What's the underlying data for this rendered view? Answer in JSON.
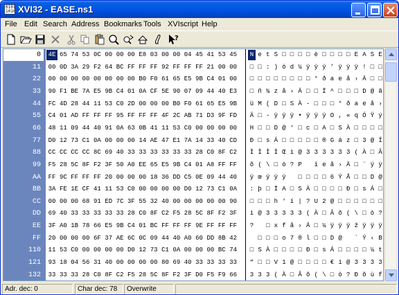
{
  "window": {
    "title": "XVI32 - EASE.ns1"
  },
  "menu": [
    "File",
    "Edit",
    "Search",
    "Address",
    "Bookmarks",
    "Tools",
    "XVIscript",
    "Help"
  ],
  "toolbar": [
    "new-file-icon",
    "open-folder-icon",
    "save-icon",
    "delete-icon",
    "cut-icon",
    "copy-icon",
    "paste-icon",
    "find-icon",
    "find-next-icon",
    "settings-icon",
    "script-icon",
    "help-pointer-icon"
  ],
  "rows": [
    {
      "addr": "0",
      "hex": [
        "4E",
        "65",
        "74",
        "53",
        "0C",
        "00",
        "00",
        "00",
        "E8",
        "03",
        "00",
        "00",
        "04",
        "45",
        "41",
        "53",
        "45"
      ],
      "txt": [
        "N",
        "e",
        "t",
        "S",
        "□",
        "□",
        "□",
        "□",
        "è",
        "□",
        "□",
        "□",
        "□",
        "E",
        "A",
        "S",
        "E"
      ]
    },
    {
      "addr": "11",
      "hex": [
        "00",
        "0D",
        "3A",
        "29",
        "F2",
        "64",
        "BC",
        "FF",
        "FF",
        "FF",
        "92",
        "FF",
        "FF",
        "FF",
        "21",
        "00",
        "00"
      ],
      "txt": [
        "□",
        "□",
        ":",
        ")",
        "ò",
        "d",
        "¼",
        "ÿ",
        "ÿ",
        "ÿ",
        "’",
        "ÿ",
        "ÿ",
        "ÿ",
        "!",
        "□",
        "□"
      ]
    },
    {
      "addr": "22",
      "hex": [
        "00",
        "00",
        "00",
        "00",
        "00",
        "00",
        "00",
        "00",
        "B0",
        "F0",
        "61",
        "65",
        "E5",
        "9B",
        "C4",
        "01",
        "00"
      ],
      "txt": [
        "□",
        "□",
        "□",
        "□",
        "□",
        "□",
        "□",
        "□",
        "°",
        "ð",
        "a",
        "e",
        "å",
        "›",
        "Ä",
        "□",
        "□"
      ]
    },
    {
      "addr": "33",
      "hex": [
        "90",
        "F1",
        "BE",
        "7A",
        "E5",
        "9B",
        "C4",
        "01",
        "0A",
        "CF",
        "5E",
        "90",
        "07",
        "09",
        "44",
        "40",
        "E3"
      ],
      "txt": [
        "□",
        "ñ",
        "¾",
        "z",
        "å",
        "›",
        "Ä",
        "□",
        "□",
        "Ï",
        "^",
        "□",
        "□",
        "□",
        "D",
        "@",
        "ã"
      ]
    },
    {
      "addr": "44",
      "hex": [
        "FC",
        "4D",
        "28",
        "44",
        "11",
        "53",
        "C0",
        "2D",
        "00",
        "00",
        "00",
        "B0",
        "F0",
        "61",
        "65",
        "E5",
        "9B"
      ],
      "txt": [
        "ü",
        "M",
        "(",
        "D",
        "□",
        "S",
        "À",
        "-",
        "□",
        "□",
        "□",
        "°",
        "ð",
        "a",
        "e",
        "å",
        "›"
      ]
    },
    {
      "addr": "55",
      "hex": [
        "C4",
        "01",
        "AD",
        "FF",
        "FF",
        "FF",
        "95",
        "FF",
        "FF",
        "FF",
        "4F",
        "2C",
        "AB",
        "71",
        "D3",
        "9F",
        "FD"
      ],
      "txt": [
        "Ä",
        "□",
        "-",
        "ÿ",
        "ÿ",
        "ÿ",
        "•",
        "ÿ",
        "ÿ",
        "ÿ",
        "O",
        ",",
        "«",
        "q",
        "Ó",
        "Ÿ",
        "ý"
      ]
    },
    {
      "addr": "66",
      "hex": [
        "48",
        "11",
        "09",
        "44",
        "40",
        "91",
        "0A",
        "63",
        "0B",
        "41",
        "11",
        "53",
        "C0",
        "00",
        "00",
        "00",
        "00"
      ],
      "txt": [
        "H",
        "□",
        "□",
        "D",
        "@",
        "‘",
        "□",
        "c",
        "□",
        "A",
        "□",
        "S",
        "À",
        "□",
        "□",
        "□",
        "□"
      ]
    },
    {
      "addr": "77",
      "hex": [
        "D0",
        "12",
        "73",
        "C1",
        "0A",
        "00",
        "00",
        "00",
        "14",
        "AE",
        "47",
        "E1",
        "7A",
        "14",
        "33",
        "40",
        "CD"
      ],
      "txt": [
        "Ð",
        "□",
        "s",
        "Á",
        "□",
        "□",
        "□",
        "□",
        "□",
        "®",
        "G",
        "á",
        "z",
        "□",
        "3",
        "@",
        "Í"
      ]
    },
    {
      "addr": "88",
      "hex": [
        "CC",
        "CC",
        "CC",
        "CC",
        "8C",
        "69",
        "40",
        "33",
        "33",
        "33",
        "33",
        "33",
        "33",
        "28",
        "C0",
        "8F",
        "C2"
      ],
      "txt": [
        "Ì",
        "Ì",
        "Ì",
        "Ì",
        "Œ",
        "i",
        "@",
        "3",
        "3",
        "3",
        "3",
        "3",
        "3",
        "(",
        "À",
        "□",
        "Â"
      ]
    },
    {
      "addr": "99",
      "hex": [
        "F5",
        "28",
        "5C",
        "8F",
        "F2",
        "3F",
        "50",
        "A0",
        "EE",
        "65",
        "E5",
        "9B",
        "C4",
        "01",
        "A8",
        "FF",
        "FF"
      ],
      "txt": [
        "õ",
        "(",
        "\\",
        "□",
        "ò",
        "?",
        "P",
        " ",
        "î",
        "e",
        "å",
        "›",
        "Ä",
        "□",
        "¨",
        "ÿ",
        "ÿ"
      ]
    },
    {
      "addr": "AA",
      "hex": [
        "FF",
        "9C",
        "FF",
        "FF",
        "FF",
        "20",
        "00",
        "00",
        "00",
        "18",
        "36",
        "DD",
        "C5",
        "0E",
        "09",
        "44",
        "40"
      ],
      "txt": [
        "ÿ",
        "œ",
        "ÿ",
        "ÿ",
        "ÿ",
        " ",
        "□",
        "□",
        "□",
        "□",
        "6",
        "Ý",
        "Å",
        "□",
        "□",
        "D",
        "@"
      ]
    },
    {
      "addr": "BB",
      "hex": [
        "3A",
        "FE",
        "1E",
        "CF",
        "41",
        "11",
        "53",
        "C0",
        "00",
        "00",
        "00",
        "00",
        "D0",
        "12",
        "73",
        "C1",
        "0A"
      ],
      "txt": [
        ":",
        "þ",
        "□",
        "Ï",
        "A",
        "□",
        "S",
        "À",
        "□",
        "□",
        "□",
        "□",
        "Ð",
        "□",
        "s",
        "Á",
        "□"
      ]
    },
    {
      "addr": "CC",
      "hex": [
        "00",
        "00",
        "00",
        "68",
        "91",
        "ED",
        "7C",
        "3F",
        "55",
        "32",
        "40",
        "00",
        "00",
        "00",
        "00",
        "00",
        "90"
      ],
      "txt": [
        "□",
        "□",
        "□",
        "h",
        "‘",
        "í",
        "|",
        "?",
        "U",
        "2",
        "@",
        "□",
        "□",
        "□",
        "□",
        "□",
        "□"
      ]
    },
    {
      "addr": "DD",
      "hex": [
        "69",
        "40",
        "33",
        "33",
        "33",
        "33",
        "33",
        "28",
        "C0",
        "8F",
        "C2",
        "F5",
        "28",
        "5C",
        "8F",
        "F2",
        "3F"
      ],
      "txt": [
        "i",
        "@",
        "3",
        "3",
        "3",
        "3",
        "3",
        "(",
        "À",
        "□",
        "Â",
        "õ",
        "(",
        "\\",
        "□",
        "ò",
        "?"
      ]
    },
    {
      "addr": "EE",
      "hex": [
        "3F",
        "A0",
        "1B",
        "78",
        "66",
        "E5",
        "9B",
        "C4",
        "01",
        "BC",
        "FF",
        "FF",
        "FF",
        "9E",
        "FF",
        "FF",
        "FF"
      ],
      "txt": [
        "?",
        " ",
        "□",
        "x",
        "f",
        "å",
        "›",
        "Ä",
        "□",
        "¼",
        "ÿ",
        "ÿ",
        "ÿ",
        "ž",
        "ÿ",
        "ÿ",
        "ÿ"
      ]
    },
    {
      "addr": "FF",
      "hex": [
        "20",
        "00",
        "00",
        "00",
        "6F",
        "37",
        "AE",
        "6C",
        "0C",
        "09",
        "44",
        "40",
        "A0",
        "60",
        "DD",
        "8B",
        "42"
      ],
      "txt": [
        " ",
        "□",
        "□",
        "□",
        "o",
        "7",
        "®",
        "l",
        "□",
        "□",
        "D",
        "@",
        " ",
        "`",
        "Ý",
        "‹",
        "B"
      ]
    },
    {
      "addr": "110",
      "hex": [
        "11",
        "53",
        "C0",
        "00",
        "00",
        "00",
        "00",
        "D0",
        "12",
        "73",
        "C1",
        "0A",
        "00",
        "00",
        "00",
        "BC",
        "74"
      ],
      "txt": [
        "□",
        "S",
        "À",
        "□",
        "□",
        "□",
        "□",
        "Ð",
        "□",
        "s",
        "Á",
        "□",
        "□",
        "□",
        "□",
        "¼",
        "t"
      ]
    },
    {
      "addr": "121",
      "hex": [
        "93",
        "18",
        "04",
        "56",
        "31",
        "40",
        "00",
        "00",
        "00",
        "00",
        "80",
        "69",
        "40",
        "33",
        "33",
        "33",
        "33"
      ],
      "txt": [
        "“",
        "□",
        "□",
        "V",
        "1",
        "@",
        "□",
        "□",
        "□",
        "□",
        "€",
        "i",
        "@",
        "3",
        "3",
        "3",
        "3"
      ]
    },
    {
      "addr": "132",
      "hex": [
        "33",
        "33",
        "33",
        "28",
        "C0",
        "8F",
        "C2",
        "F5",
        "28",
        "5C",
        "8F",
        "F2",
        "3F",
        "D0",
        "F5",
        "F9",
        "66"
      ],
      "txt": [
        "3",
        "3",
        "3",
        "(",
        "À",
        "□",
        "Â",
        "õ",
        "(",
        "\\",
        "□",
        "ò",
        "?",
        "Ð",
        "õ",
        "ù",
        "f"
      ]
    }
  ],
  "status": {
    "addr": "Adr. dec: 0",
    "char": "Char dec: 78",
    "mode": "Overwrite"
  },
  "colors": {
    "title_bar": "#0055e5",
    "addr_column": "#6b86bd",
    "cursor": "#0a246a"
  }
}
